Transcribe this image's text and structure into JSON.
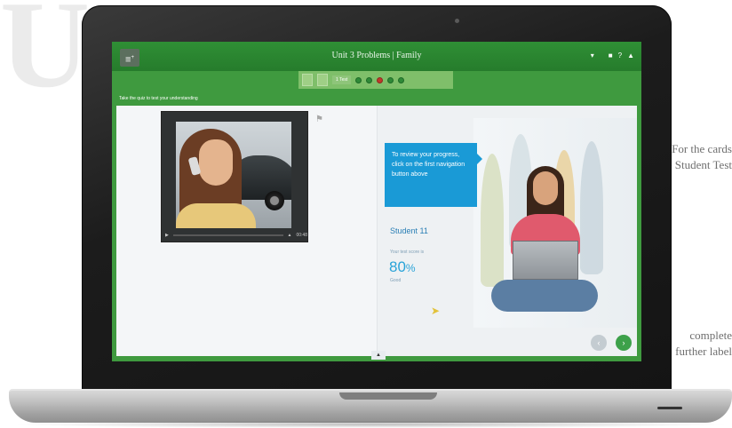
{
  "app": {
    "title": "Unit 3 Problems | Family",
    "menu_label": "≡",
    "tool_icons": [
      "▾",
      "■",
      "?",
      "▲"
    ]
  },
  "progress": {
    "current_step_label": "1 Test",
    "step_status_colors": [
      "#2f8a38",
      "#2f8a38",
      "#c0392b",
      "#2f8a38",
      "#2f8a38"
    ]
  },
  "instruction": "Take the quiz to test your understanding",
  "media": {
    "time": "00:48",
    "play_icon": "play-icon",
    "volume_icon": "volume-icon"
  },
  "tooltip": {
    "text": "To review your progress, click on the first navigation button above"
  },
  "student": {
    "name": "Student 11",
    "score_label": "Your test score is",
    "score_value": "80",
    "score_unit": "%",
    "score_sub": "Good"
  },
  "nav": {
    "prev": "‹",
    "next": "›",
    "collapse": "▲"
  },
  "background": {
    "big_letters": "Un",
    "line1": "Ideas, for purposes of completing the test. For the cards",
    "line2": "lesson and cars. In the chart of the Student Test",
    "line3": "complete",
    "line4": "further label"
  }
}
